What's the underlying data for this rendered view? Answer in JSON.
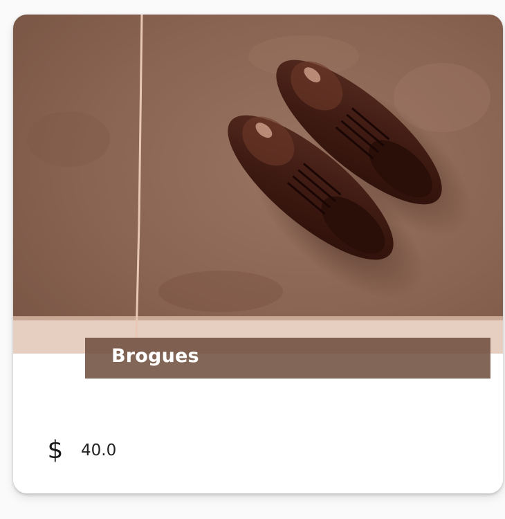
{
  "product": {
    "name": "Brogues",
    "price": "40.0",
    "currency_icon": "dollar-icon",
    "currency_symbol": "$",
    "image_alt": "brown-brogue-shoes-photo"
  },
  "colors": {
    "card_bg": "#ffffff",
    "title_band": "#6e4e3e",
    "title_text": "#ffffff",
    "price_text": "#222222"
  }
}
